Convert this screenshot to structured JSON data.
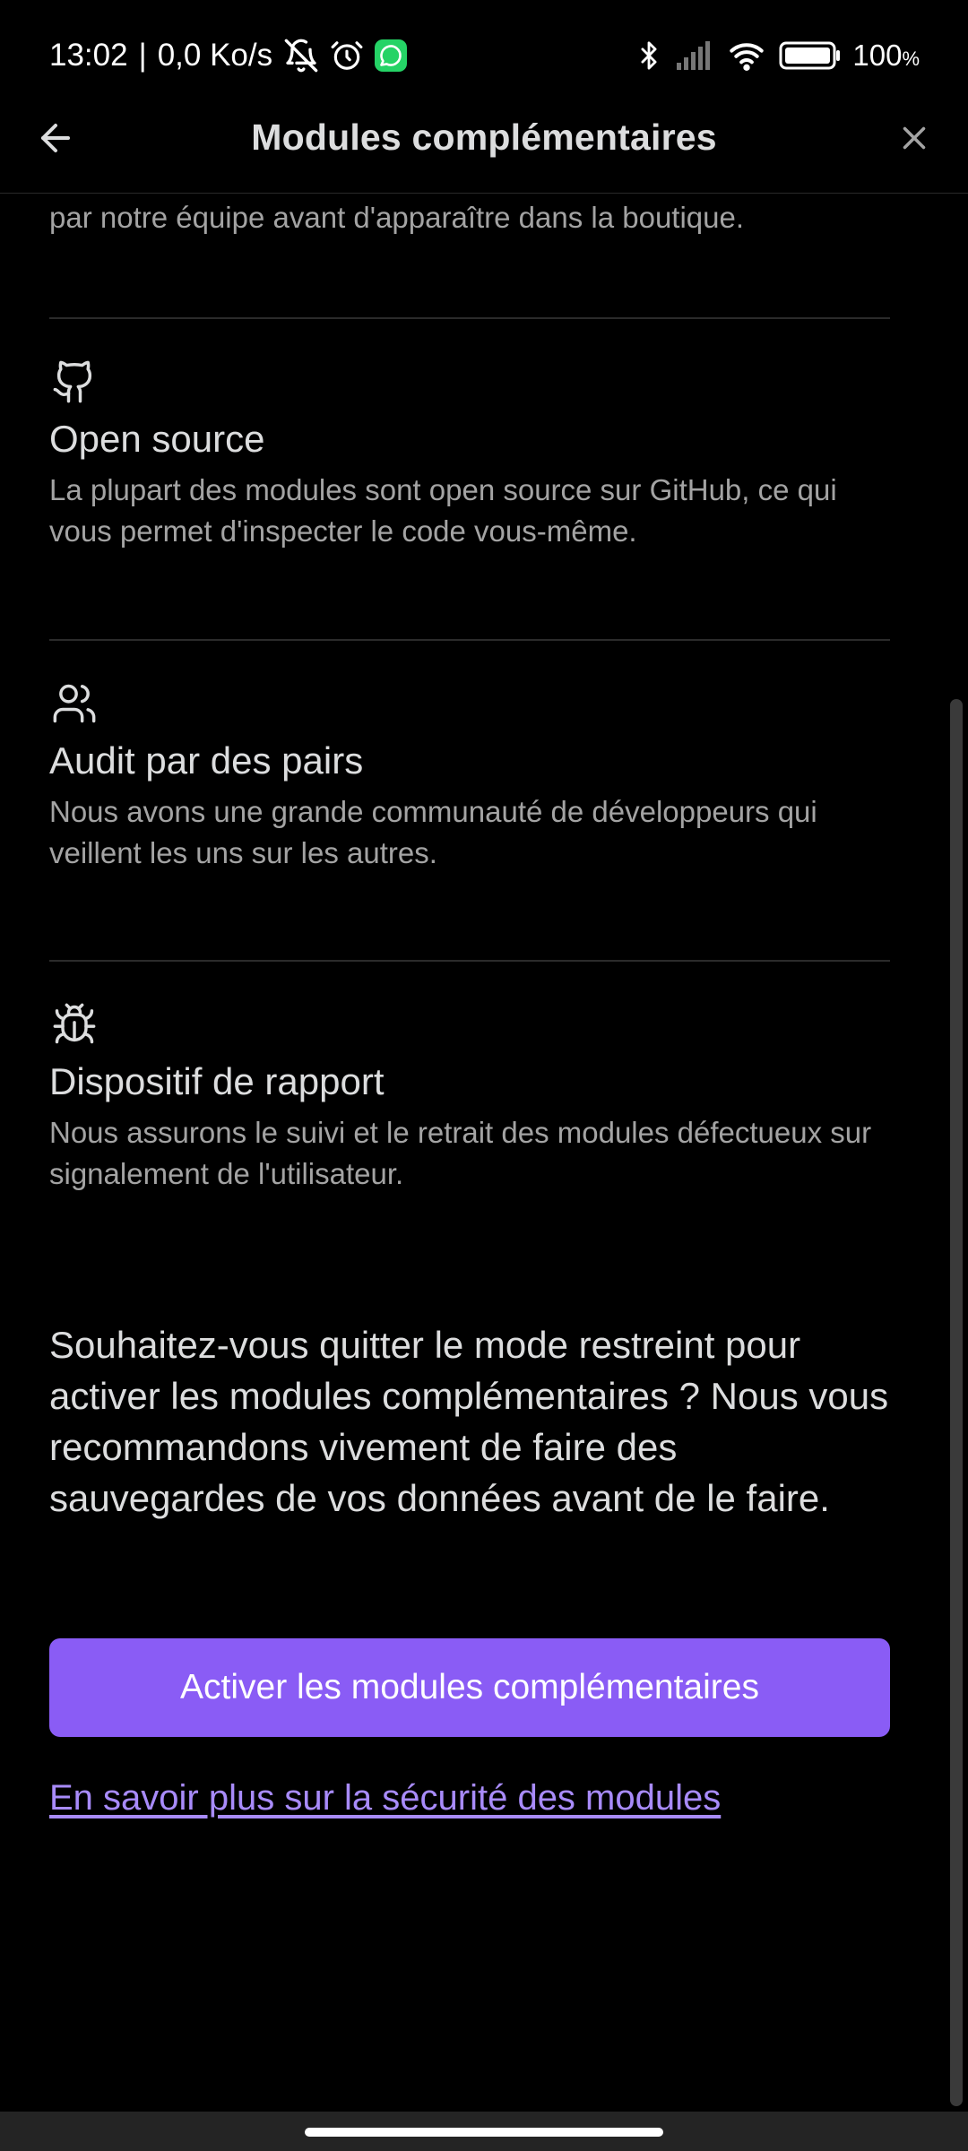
{
  "status_bar": {
    "time": "13:02",
    "separator": "|",
    "net_speed": "0,0 Ko/s",
    "battery_percent": "100",
    "battery_unit": "%"
  },
  "header": {
    "title": "Modules complémentaires",
    "back_icon": "arrow-left-icon",
    "close_icon": "close-icon"
  },
  "cut_text": "par notre équipe avant d'apparaître dans la boutique.",
  "features": [
    {
      "icon": "github-icon",
      "title": "Open source",
      "description": "La plupart des modules sont open source sur GitHub, ce qui vous permet d'inspecter le code vous-même."
    },
    {
      "icon": "users-icon",
      "title": "Audit par des pairs",
      "description": "Nous avons une grande communauté de développeurs qui veillent les uns sur les autres."
    },
    {
      "icon": "bug-icon",
      "title": "Dispositif de rapport",
      "description": "Nous assurons le suivi et le retrait des modules défectueux sur signalement de l'utilisateur."
    }
  ],
  "prompt": "Souhaitez-vous quitter le mode restreint pour activer les modules complémentaires ? Nous vous recommandons vivement de faire des sauvegardes de vos données avant de le faire.",
  "primary_button": "Activer les modules complémentaires",
  "learn_more_link": "En savoir plus sur la sécurité des modules",
  "colors": {
    "background": "#000000",
    "accent": "#8a5cf5",
    "link": "#a88bfa",
    "text": "#dcddde",
    "muted_text": "#a3a3a3"
  }
}
